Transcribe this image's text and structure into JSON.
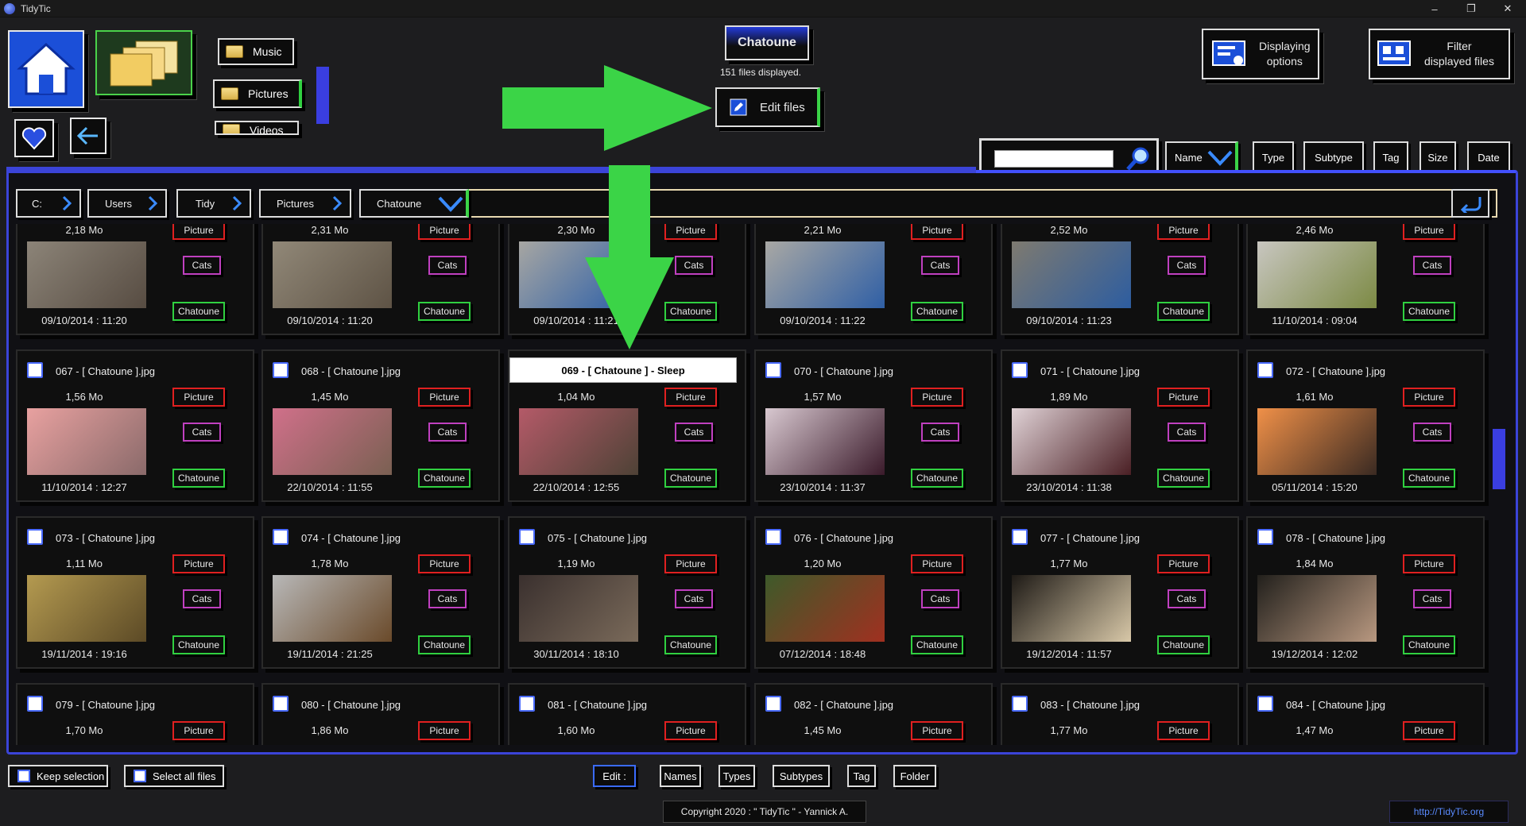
{
  "app": {
    "title": "TidyTic"
  },
  "window": {
    "minimize": "–",
    "restore": "❐",
    "close": "✕"
  },
  "nav": {
    "folders": {
      "music": "Music",
      "pictures": "Pictures",
      "videos": "Videos"
    }
  },
  "header": {
    "folder_name": "Chatoune",
    "files_count": "151 files displayed.",
    "edit_files": "Edit files",
    "displaying_options": [
      "Displaying",
      "options"
    ],
    "filter_files": [
      "Filter",
      "displayed files"
    ]
  },
  "sort": {
    "name": "Name",
    "type": "Type",
    "subtype": "Subtype",
    "tag": "Tag",
    "size": "Size",
    "date": "Date"
  },
  "search": {
    "placeholder": ""
  },
  "breadcrumb": [
    "C:",
    "Users",
    "Tidy",
    "Pictures",
    "Chatoune"
  ],
  "tags": {
    "type": "Picture",
    "subtype": "Cats",
    "tag": "Chatoune"
  },
  "row0": [
    {
      "size": "2,18 Mo",
      "date": "09/10/2014 : 11:20",
      "colors": [
        "#8c8478",
        "#574c42"
      ]
    },
    {
      "size": "2,31 Mo",
      "date": "09/10/2014 : 11:20",
      "colors": [
        "#918878",
        "#5e5345"
      ]
    },
    {
      "size": "2,30 Mo",
      "date": "09/10/2014 : 11:21",
      "colors": [
        "#a7a6a2",
        "#2a5ea8"
      ]
    },
    {
      "size": "2,21 Mo",
      "date": "09/10/2014 : 11:22",
      "colors": [
        "#a9a8a4",
        "#2f5fa5"
      ]
    },
    {
      "size": "2,52 Mo",
      "date": "09/10/2014 : 11:23",
      "colors": [
        "#7e7a70",
        "#2d5da0"
      ]
    },
    {
      "size": "2,46 Mo",
      "date": "11/10/2014 : 09:04",
      "colors": [
        "#c8c6c0",
        "#7c8a44"
      ]
    }
  ],
  "row1": [
    {
      "name": "067 - [ Chatoune ].jpg",
      "size": "1,56 Mo",
      "date": "11/10/2014 : 12:27",
      "colors": [
        "#e8a1a0",
        "#8a6a6a"
      ]
    },
    {
      "name": "068 - [ Chatoune ].jpg",
      "size": "1,45 Mo",
      "date": "22/10/2014 : 11:55",
      "colors": [
        "#d0708a",
        "#7a6052"
      ]
    },
    {
      "name": "069 - [ Chatoune ] - Sleep",
      "size": "1,04 Mo",
      "date": "22/10/2014 : 12:55",
      "colors": [
        "#b45a68",
        "#4e4236"
      ]
    },
    {
      "name": "070 - [ Chatoune ].jpg",
      "size": "1,57 Mo",
      "date": "23/10/2014 : 11:37",
      "colors": [
        "#d8c8d0",
        "#3a1a2a"
      ]
    },
    {
      "name": "071 - [ Chatoune ].jpg",
      "size": "1,89 Mo",
      "date": "23/10/2014 : 11:38",
      "colors": [
        "#e0d2d6",
        "#4a1f24"
      ]
    },
    {
      "name": "072 - [ Chatoune ].jpg",
      "size": "1,61 Mo",
      "date": "05/11/2014 : 15:20",
      "colors": [
        "#f09048",
        "#3a2a22"
      ]
    }
  ],
  "row2": [
    {
      "name": "073 - [ Chatoune ].jpg",
      "size": "1,11 Mo",
      "date": "19/11/2014 : 19:16",
      "colors": [
        "#b49a50",
        "#5c4a26"
      ]
    },
    {
      "name": "074 - [ Chatoune ].jpg",
      "size": "1,78 Mo",
      "date": "19/11/2014 : 21:25",
      "colors": [
        "#b8b8b8",
        "#6a4a2a"
      ]
    },
    {
      "name": "075 - [ Chatoune ].jpg",
      "size": "1,19 Mo",
      "date": "30/11/2014 : 18:10",
      "colors": [
        "#3a302e",
        "#7a6a5a"
      ]
    },
    {
      "name": "076 - [ Chatoune ].jpg",
      "size": "1,20 Mo",
      "date": "07/12/2014 : 18:48",
      "colors": [
        "#3e5a2a",
        "#a03020"
      ]
    },
    {
      "name": "077 - [ Chatoune ].jpg",
      "size": "1,77 Mo",
      "date": "19/12/2014 : 11:57",
      "colors": [
        "#1e1a16",
        "#d8c8a8"
      ]
    },
    {
      "name": "078 - [ Chatoune ].jpg",
      "size": "1,84 Mo",
      "date": "19/12/2014 : 12:02",
      "colors": [
        "#22201c",
        "#b89880"
      ]
    }
  ],
  "row3": [
    {
      "name": "079 - [ Chatoune ].jpg",
      "size": "1,70 Mo"
    },
    {
      "name": "080 - [ Chatoune ].jpg",
      "size": "1,86 Mo"
    },
    {
      "name": "081 - [ Chatoune ].jpg",
      "size": "1,60 Mo"
    },
    {
      "name": "082 - [ Chatoune ].jpg",
      "size": "1,45 Mo"
    },
    {
      "name": "083 - [ Chatoune ].jpg",
      "size": "1,77 Mo"
    },
    {
      "name": "084 - [ Chatoune ].jpg",
      "size": "1,47 Mo"
    }
  ],
  "bottom": {
    "keep_selection": "Keep selection",
    "select_all": "Select all files",
    "edit": "Edit :",
    "names": "Names",
    "types": "Types",
    "subtypes": "Subtypes",
    "tag": "Tag",
    "folder": "Folder"
  },
  "footer": {
    "copyright": "Copyright 2020 : \" TidyTic \" - Yannick A.",
    "url": "http://TidyTic.org"
  },
  "colors": {
    "accent_blue": "#3b44d8",
    "arrow_green": "#3bd447",
    "type_red": "#e02020",
    "subtype_purple": "#c040c0",
    "tag_green": "#30d040"
  }
}
